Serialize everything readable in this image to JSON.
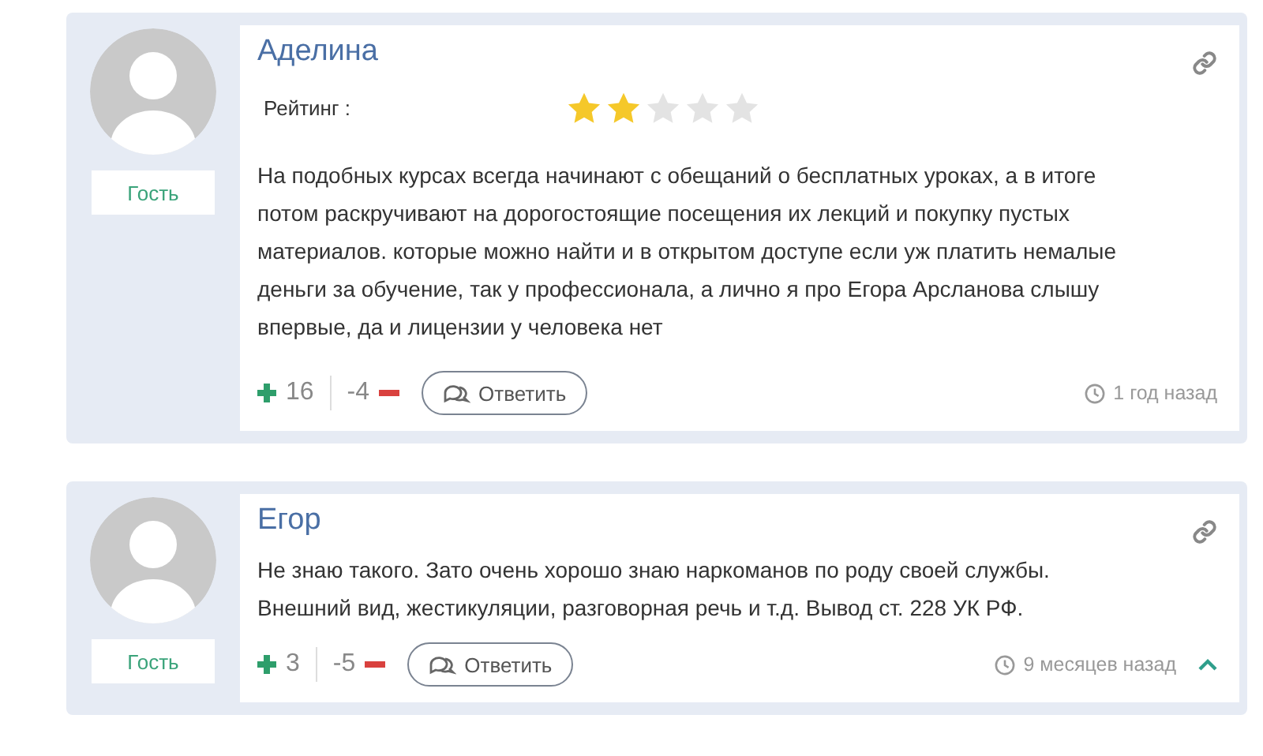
{
  "comments": [
    {
      "author": "Аделина",
      "role": "Гость",
      "rating_label": "Рейтинг :",
      "stars": 2,
      "text": "На подобных курсах всегда начинают с обещаний о бесплатных уроках, а в итоге\nпотом раскручивают на дорогостоящие посещения их лекций и покупку пустых\nматериалов. которые можно найти и в открытом доступе если уж платить немалые\nденьги за обучение, так у профессионала, а лично я про Егора Арсланова слышу\nвпервые, да и лицензии у человека нет",
      "likes": "16",
      "dislikes": "-4",
      "reply": "Ответить",
      "time": "1 год назад",
      "collapse": false
    },
    {
      "author": "Егор",
      "role": "Гость",
      "text": "Не знаю такого. Зато очень хорошо знаю наркоманов по роду своей службы.\nВнешний вид, жестикуляции, разговорная речь и т.д. Вывод ст. 228 УК РФ.",
      "likes": "3",
      "dislikes": "-5",
      "reply": "Ответить",
      "time": "9 месяцев назад",
      "collapse": true
    }
  ]
}
